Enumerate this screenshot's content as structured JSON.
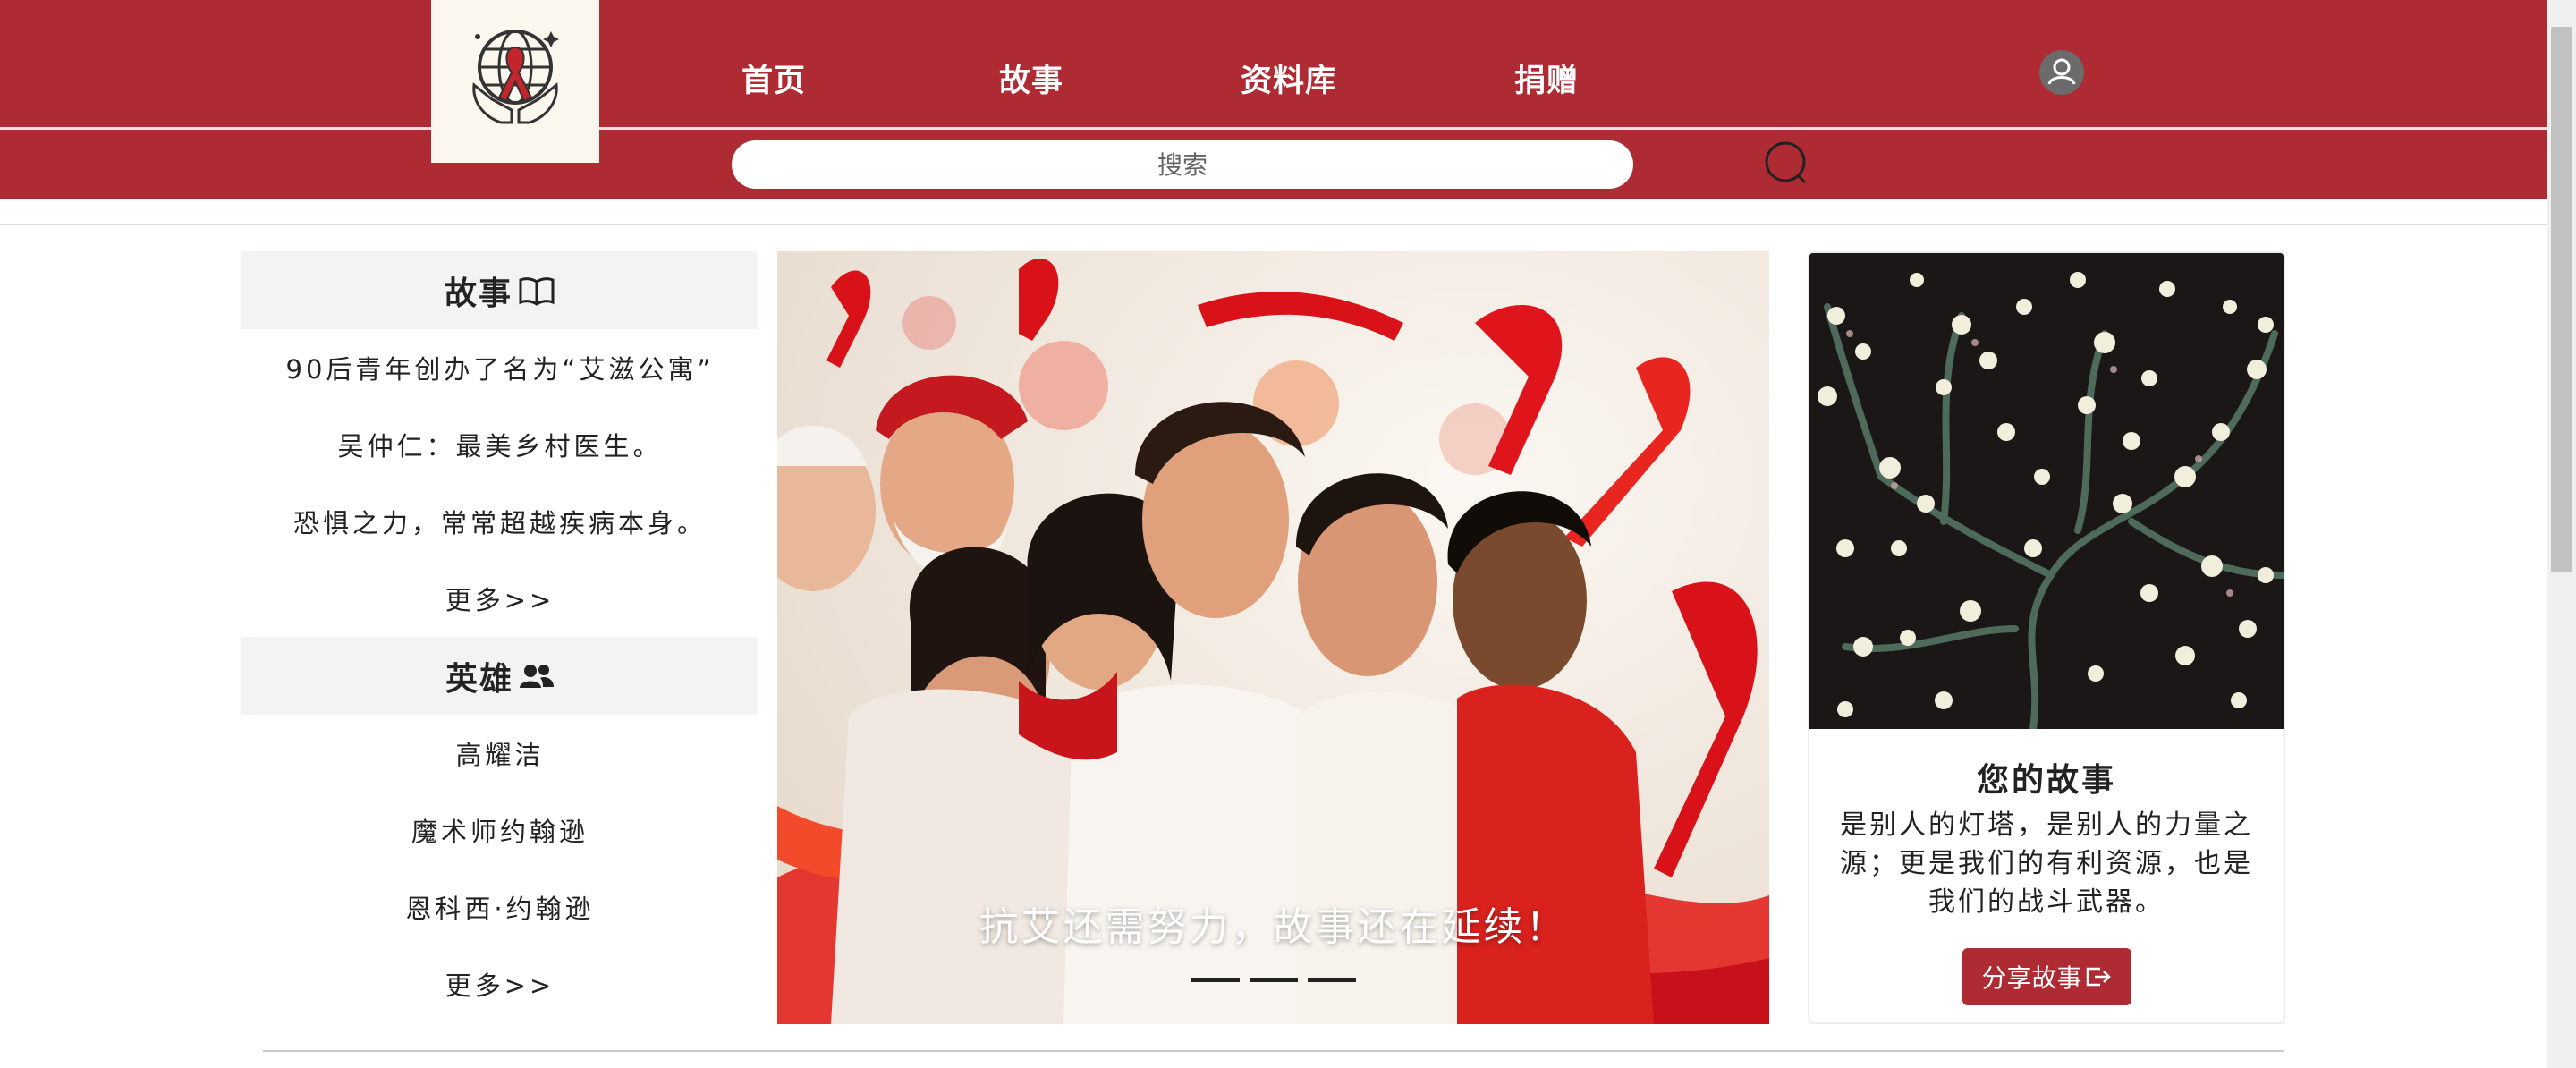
{
  "header": {
    "logo_icon": "ribbon-globe-hands-logo",
    "nav": [
      {
        "label": "首页"
      },
      {
        "label": "故事"
      },
      {
        "label": "资料库"
      },
      {
        "label": "捐赠"
      }
    ],
    "user_icon": "user-icon",
    "brand_color": "#ae2b33"
  },
  "search": {
    "placeholder": "搜索",
    "value": "",
    "icon": "search-icon"
  },
  "stories": {
    "title": "故事",
    "title_icon": "open-book-icon",
    "items": [
      {
        "label": "90后青年创办了名为“艾滋公寓”"
      },
      {
        "label": "吴仲仁：最美乡村医生。"
      },
      {
        "label": "恐惧之力，常常超越疾病本身。"
      }
    ],
    "more_label": "更多>>"
  },
  "heroes": {
    "title": "英雄",
    "title_icon": "users-icon",
    "items": [
      {
        "label": "高耀洁"
      },
      {
        "label": "魔术师约翰逊"
      },
      {
        "label": "恩科西·约翰逊"
      }
    ],
    "more_label": "更多>>"
  },
  "carousel": {
    "caption": "抗艾还需努力，故事还在延续！",
    "slides": 3,
    "active_slide": 1
  },
  "your_story": {
    "title": "您的故事",
    "text": "是别人的灯塔，是别人的力量之源；更是我们的有利资源，也是我们的战斗武器。",
    "button_label": "分享故事",
    "button_icon": "share-icon"
  }
}
